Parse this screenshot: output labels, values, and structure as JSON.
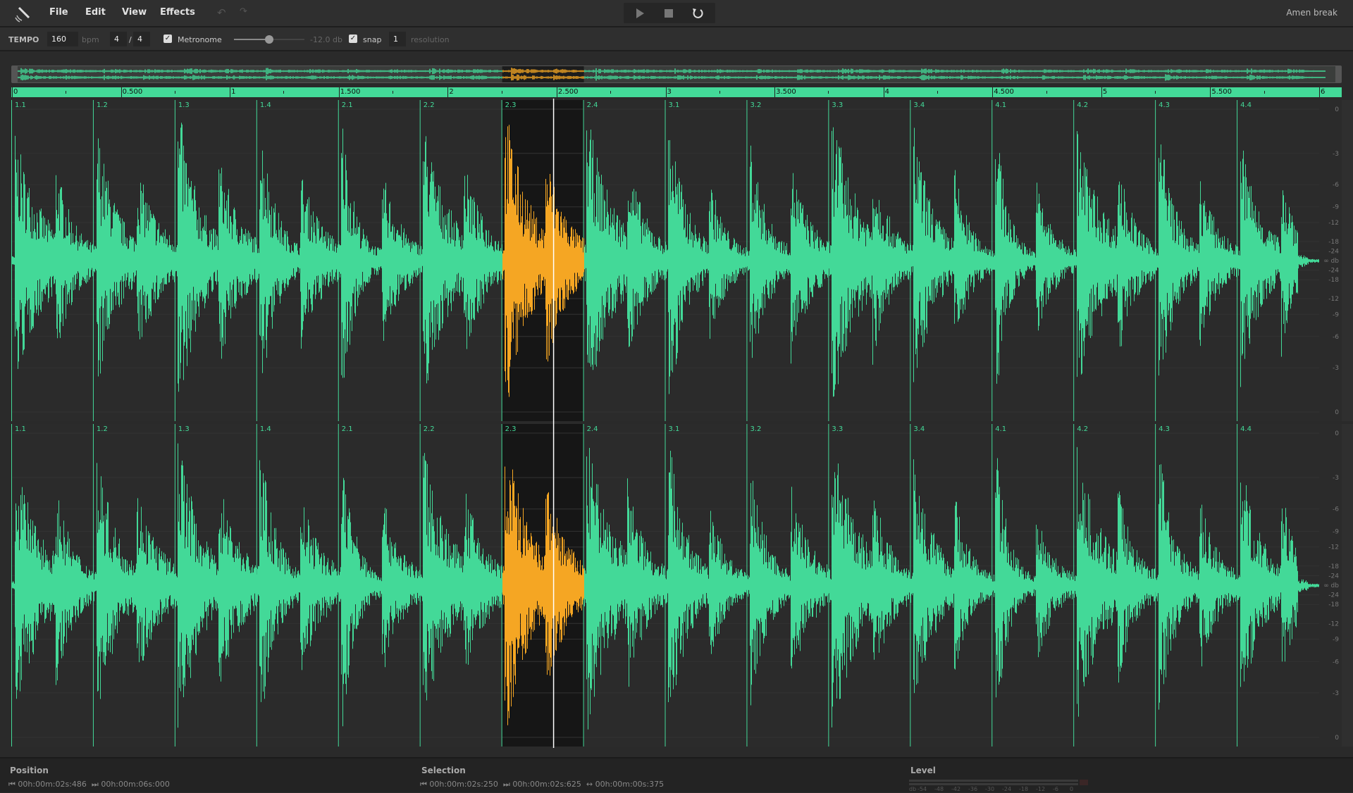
{
  "app": {
    "title": "Amen break",
    "logo": "satellite-icon"
  },
  "menu": [
    "File",
    "Edit",
    "View",
    "Effects"
  ],
  "toolbar": {
    "tempo_label": "TEMPO",
    "tempo": "160",
    "bpm_label": "bpm",
    "sig_num": "4",
    "sig_sep": "/",
    "sig_den": "4",
    "metronome_checked": true,
    "metronome_label": "Metronome",
    "metronome_volume_db": -12.0,
    "volume_text": "-12.0 db",
    "snap_checked": true,
    "snap_label": "snap",
    "resolution": "1",
    "resolution_label": "resolution"
  },
  "transport": {
    "play": "play-icon",
    "stop": "stop-icon",
    "loop": "loop-icon"
  },
  "timeline": {
    "duration_s": 6.0,
    "tempo_bpm": 160,
    "ruler_labels": [
      "0",
      "0.500",
      "1",
      "1.500",
      "2",
      "2.500",
      "3",
      "3.500",
      "4",
      "4.500",
      "5",
      "5.500",
      "6"
    ],
    "bar_labels": [
      "1.1",
      "1.2",
      "1.3",
      "1.4",
      "2.1",
      "2.2",
      "2.3",
      "2.4",
      "3.1",
      "3.2",
      "3.3",
      "3.4",
      "4.1",
      "4.2",
      "4.3",
      "4.4"
    ],
    "cursor_s": 2.486,
    "selection_start_s": 2.25,
    "selection_end_s": 2.625
  },
  "db_scale": [
    "0",
    "-3",
    "-6",
    "-9",
    "-12",
    "-18",
    "-24",
    "∞ db",
    "-24",
    "-18",
    "-12",
    "-9",
    "-6",
    "-3",
    "0"
  ],
  "status": {
    "position_label": "Position",
    "position": "00h:00m:02s:486",
    "length": "00h:00m:06s:000",
    "selection_label": "Selection",
    "sel_start": "00h:00m:02s:250",
    "sel_end": "00h:00m:02s:625",
    "sel_length": "00h:00m:00s:375",
    "level_label": "Level",
    "level_ticks": [
      "db",
      "-54",
      "-48",
      "-42",
      "-36",
      "-30",
      "-24",
      "-18",
      "-12",
      "-6",
      "0"
    ]
  },
  "colors": {
    "waveform": "#43d998",
    "selection": "#f5a623",
    "cursor": "#ffffff",
    "background": "#2b2b2b"
  }
}
